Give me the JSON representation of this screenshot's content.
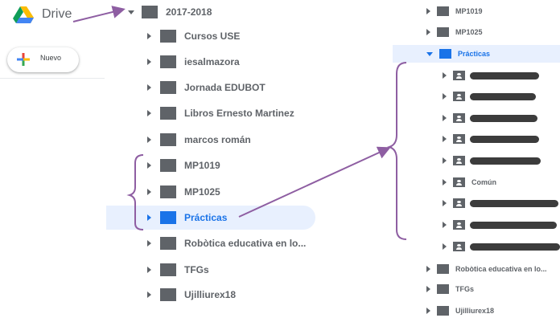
{
  "header": {
    "app_title": "Drive",
    "logo_icon": "google-drive-icon"
  },
  "new_button": {
    "label": "Nuevo"
  },
  "tree": {
    "root": {
      "label": "2017-2018"
    },
    "children": [
      {
        "label": "Cursos USE"
      },
      {
        "label": "iesalmazora"
      },
      {
        "label": "Jornada EDUBOT"
      },
      {
        "label": "Libros Ernesto Martinez"
      },
      {
        "label": "marcos román"
      },
      {
        "label": "MP1019"
      },
      {
        "label": "MP1025"
      },
      {
        "label": "Prácticas",
        "selected": true
      },
      {
        "label": "Robòtica educativa en lo..."
      },
      {
        "label": "TFGs"
      },
      {
        "label": "Ujilliurex18"
      }
    ]
  },
  "zoom_panel": {
    "items": [
      {
        "label": "MP1019"
      },
      {
        "label": "MP1025"
      },
      {
        "label": "Prácticas",
        "expanded": true
      },
      {
        "label": "",
        "redacted": true
      },
      {
        "label": "",
        "redacted": true
      },
      {
        "label": "",
        "redacted": true
      },
      {
        "label": "",
        "redacted": true
      },
      {
        "label": "",
        "redacted": true
      },
      {
        "label": "Común"
      },
      {
        "label": "",
        "redacted": true
      },
      {
        "label": "",
        "redacted": true
      },
      {
        "label": "",
        "redacted": true
      },
      {
        "label": "Robòtica educativa en lo..."
      },
      {
        "label": "TFGs"
      },
      {
        "label": "Ujilliurex18"
      }
    ]
  },
  "colors": {
    "accent": "#1a73e8",
    "icon_gray": "#5f6368",
    "selected_bg": "#e8f0fe",
    "annotation": "#8e5ea2"
  }
}
